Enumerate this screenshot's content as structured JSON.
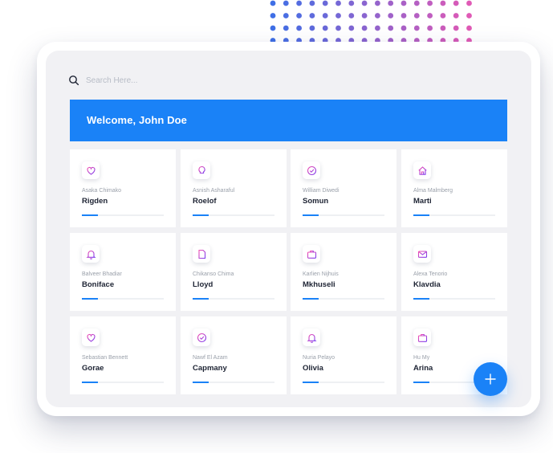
{
  "search": {
    "placeholder": "Search Here..."
  },
  "banner": {
    "welcome": "Welcome, John Doe"
  },
  "colors": {
    "accent": "#1a82f7",
    "icon_gradient_start": "#f24fb1",
    "icon_gradient_end": "#7b3cf0",
    "dots_start": "#3f6fe6",
    "dots_end": "#e05ab6"
  },
  "cards": [
    {
      "icon": "heart-icon",
      "subtitle": "Asaka Chimako",
      "title": "Rigden",
      "progress": 0.2
    },
    {
      "icon": "lightbulb-icon",
      "subtitle": "Asnish Asharaful",
      "title": "Roelof",
      "progress": 0.2
    },
    {
      "icon": "check-circle-icon",
      "subtitle": "William Diwedi",
      "title": "Somun",
      "progress": 0.2
    },
    {
      "icon": "home-icon",
      "subtitle": "Alma Malmberg",
      "title": "Marti",
      "progress": 0.2
    },
    {
      "icon": "bell-icon",
      "subtitle": "Balveer Bhadiar",
      "title": "Boniface",
      "progress": 0.2
    },
    {
      "icon": "document-icon",
      "subtitle": "Chikanso Chima",
      "title": "Lloyd",
      "progress": 0.2
    },
    {
      "icon": "briefcase-icon",
      "subtitle": "Karlien Nijhuis",
      "title": "Mkhuseli",
      "progress": 0.2
    },
    {
      "icon": "mail-icon",
      "subtitle": "Alexa Tenorio",
      "title": "Klavdia",
      "progress": 0.2
    },
    {
      "icon": "heart-icon",
      "subtitle": "Sebastian Bennett",
      "title": "Gorae",
      "progress": 0.2
    },
    {
      "icon": "check-circle-icon",
      "subtitle": "Nawf El Azam",
      "title": "Capmany",
      "progress": 0.2
    },
    {
      "icon": "bell-icon",
      "subtitle": "Nuria Pelayo",
      "title": "Olivia",
      "progress": 0.2
    },
    {
      "icon": "briefcase-icon",
      "subtitle": "Hu My",
      "title": "Arina",
      "progress": 0.2
    }
  ],
  "fab": {
    "icon": "plus-icon"
  }
}
